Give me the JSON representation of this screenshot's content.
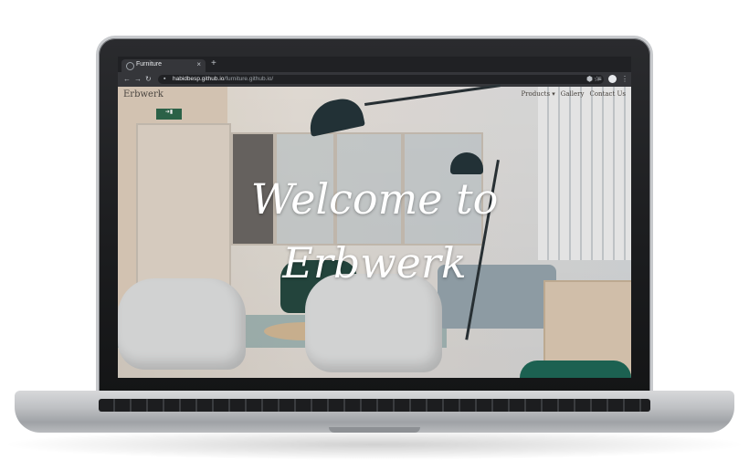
{
  "browser": {
    "tab_title": "Furniture",
    "tab_close": "×",
    "new_tab": "+",
    "back_icon": "←",
    "forward_icon": "→",
    "reload_icon": "↻",
    "lock_icon": "🔒",
    "url_host": "habidbesp.github.io",
    "url_path": "/furniture.github.io/",
    "star_icon": "☆",
    "extension_icon": "⬢",
    "media_icon": "≡",
    "menu_icon": "⋮"
  },
  "site": {
    "brand": "Erbwerk",
    "nav": [
      "Products ▾",
      "Gallery",
      "Contact Us"
    ],
    "hero_line1": "Welcome to",
    "hero_line2": "Erbwerk",
    "exit_sign": "➜▮"
  }
}
